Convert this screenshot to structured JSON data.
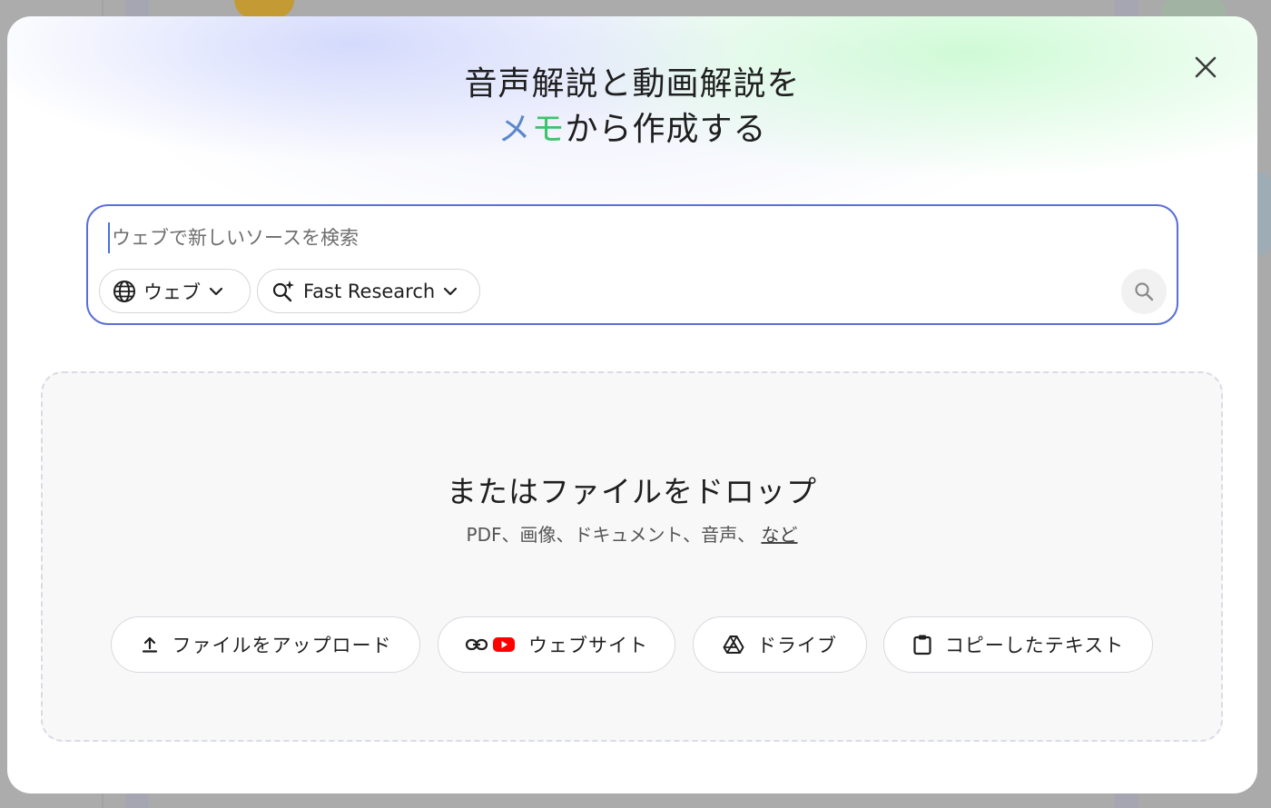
{
  "modal": {
    "headline_line1": "音声解説と動画解説を",
    "headline_memo_me": "メ",
    "headline_memo_mo": "モ",
    "headline_line2_rest": "から作成する",
    "close_icon": "close-icon"
  },
  "search": {
    "placeholder": "ウェブで新しいソースを検索",
    "source_chip_label": "ウェブ",
    "mode_chip_label": "Fast Research"
  },
  "drop": {
    "title": "またはファイルをドロップ",
    "subtitle": "PDF、画像、ドキュメント、音声、",
    "more_link": "など"
  },
  "sources": {
    "upload_label": "ファイルをアップロード",
    "website_label": "ウェブサイト",
    "drive_label": "ドライブ",
    "text_label": "コピーしたテキスト"
  },
  "colors": {
    "accent_border": "#5b6fd6",
    "memo_blue": "#5a88c9",
    "memo_green": "#3cc46a",
    "youtube_red": "#ff0000"
  }
}
